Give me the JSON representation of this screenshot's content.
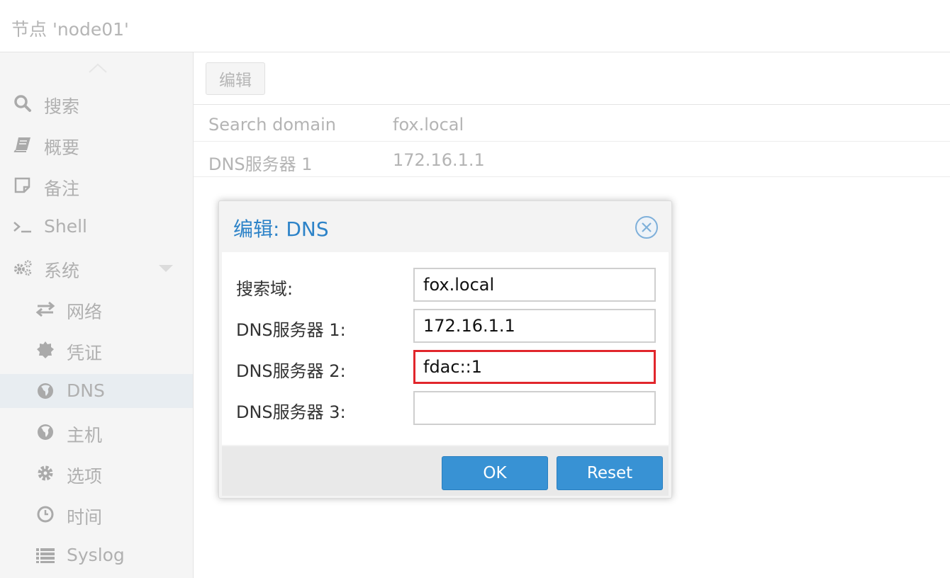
{
  "header": {
    "title": "节点 'node01'"
  },
  "sidebar": {
    "items": [
      {
        "label": "搜索",
        "icon": "search-icon"
      },
      {
        "label": "概要",
        "icon": "book-icon"
      },
      {
        "label": "备注",
        "icon": "note-icon"
      },
      {
        "label": "Shell",
        "icon": "terminal-icon"
      },
      {
        "label": "系统",
        "icon": "gears-icon"
      },
      {
        "label": "网络",
        "icon": "exchange-icon"
      },
      {
        "label": "凭证",
        "icon": "certificate-icon"
      },
      {
        "label": "DNS",
        "icon": "globe-icon",
        "active": true
      },
      {
        "label": "主机",
        "icon": "globe-icon"
      },
      {
        "label": "选项",
        "icon": "gear-icon"
      },
      {
        "label": "时间",
        "icon": "clock-icon"
      },
      {
        "label": "Syslog",
        "icon": "list-icon"
      }
    ]
  },
  "toolbar": {
    "edit_label": "编辑"
  },
  "grid": {
    "rows": [
      {
        "key": "Search domain",
        "value": "fox.local"
      },
      {
        "key": "DNS服务器 1",
        "value": "172.16.1.1"
      }
    ]
  },
  "dialog": {
    "title": "编辑: DNS",
    "fields": [
      {
        "label": "搜索域:",
        "value": "fox.local"
      },
      {
        "label": "DNS服务器 1:",
        "value": "172.16.1.1"
      },
      {
        "label": "DNS服务器 2:",
        "value": "fdac::1",
        "highlighted": true
      },
      {
        "label": "DNS服务器 3:",
        "value": ""
      }
    ],
    "ok_label": "OK",
    "reset_label": "Reset"
  },
  "colors": {
    "accent": "#3892d4",
    "title_blue": "#2d83c8",
    "highlight_red": "#e1262c",
    "active_nav": "#e8edf1"
  }
}
